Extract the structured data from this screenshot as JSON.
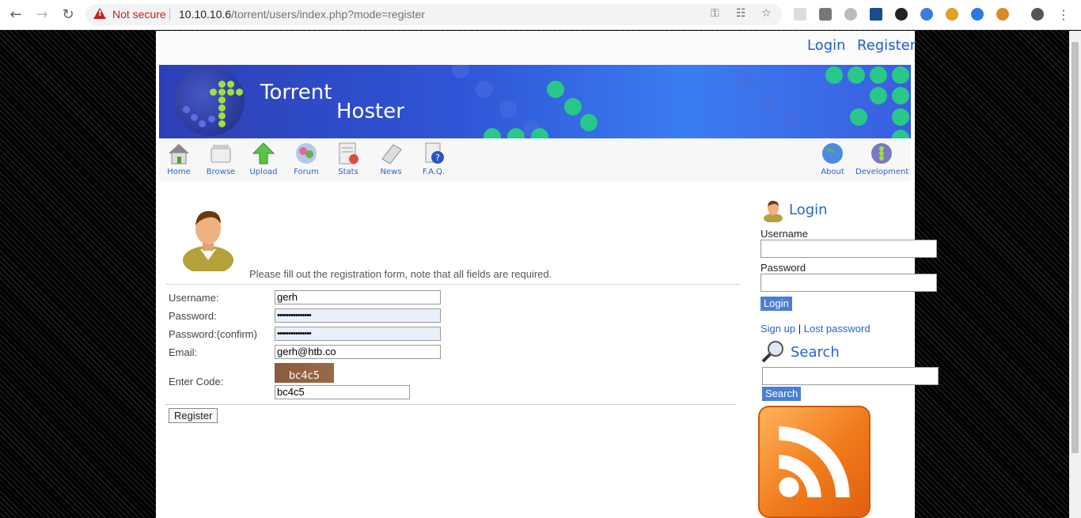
{
  "browser": {
    "security_label": "Not secure",
    "url_host": "10.10.10.6",
    "url_path": "/torrent/users/index.php?mode=register"
  },
  "header": {
    "login_link": "Login",
    "register_link": "Register"
  },
  "banner": {
    "title_line1": "Torrent",
    "title_line2": "Hoster"
  },
  "nav": {
    "items": [
      {
        "label": "Home",
        "icon": "home-icon"
      },
      {
        "label": "Browse",
        "icon": "browse-icon"
      },
      {
        "label": "Upload",
        "icon": "upload-icon"
      },
      {
        "label": "Forum",
        "icon": "forum-icon"
      },
      {
        "label": "Stats",
        "icon": "stats-icon"
      },
      {
        "label": "News",
        "icon": "news-icon"
      },
      {
        "label": "F.A.Q.",
        "icon": "faq-icon"
      }
    ],
    "right_items": [
      {
        "label": "About",
        "icon": "about-icon"
      },
      {
        "label": "Development",
        "icon": "development-icon"
      }
    ]
  },
  "form": {
    "intro": "Please fill out the registration form, note that all fields are required.",
    "username_label": "Username:",
    "username_value": "gerh",
    "password_label": "Password:",
    "password_value": "•••••••••••••••",
    "password_confirm_label": "Password:(confirm)",
    "password_confirm_value": "•••••••••••••••",
    "email_label": "Email:",
    "email_value": "gerh@htb.co",
    "code_label": "Enter Code:",
    "captcha_text": "bc4c5",
    "code_value": "bc4c5",
    "submit_label": "Register"
  },
  "sidebar": {
    "login_heading": "Login",
    "username_label": "Username",
    "password_label": "Password",
    "login_button": "Login",
    "signup_link": "Sign up",
    "separator": "|",
    "lost_password_link": "Lost password",
    "search_heading": "Search",
    "search_button": "Search"
  }
}
